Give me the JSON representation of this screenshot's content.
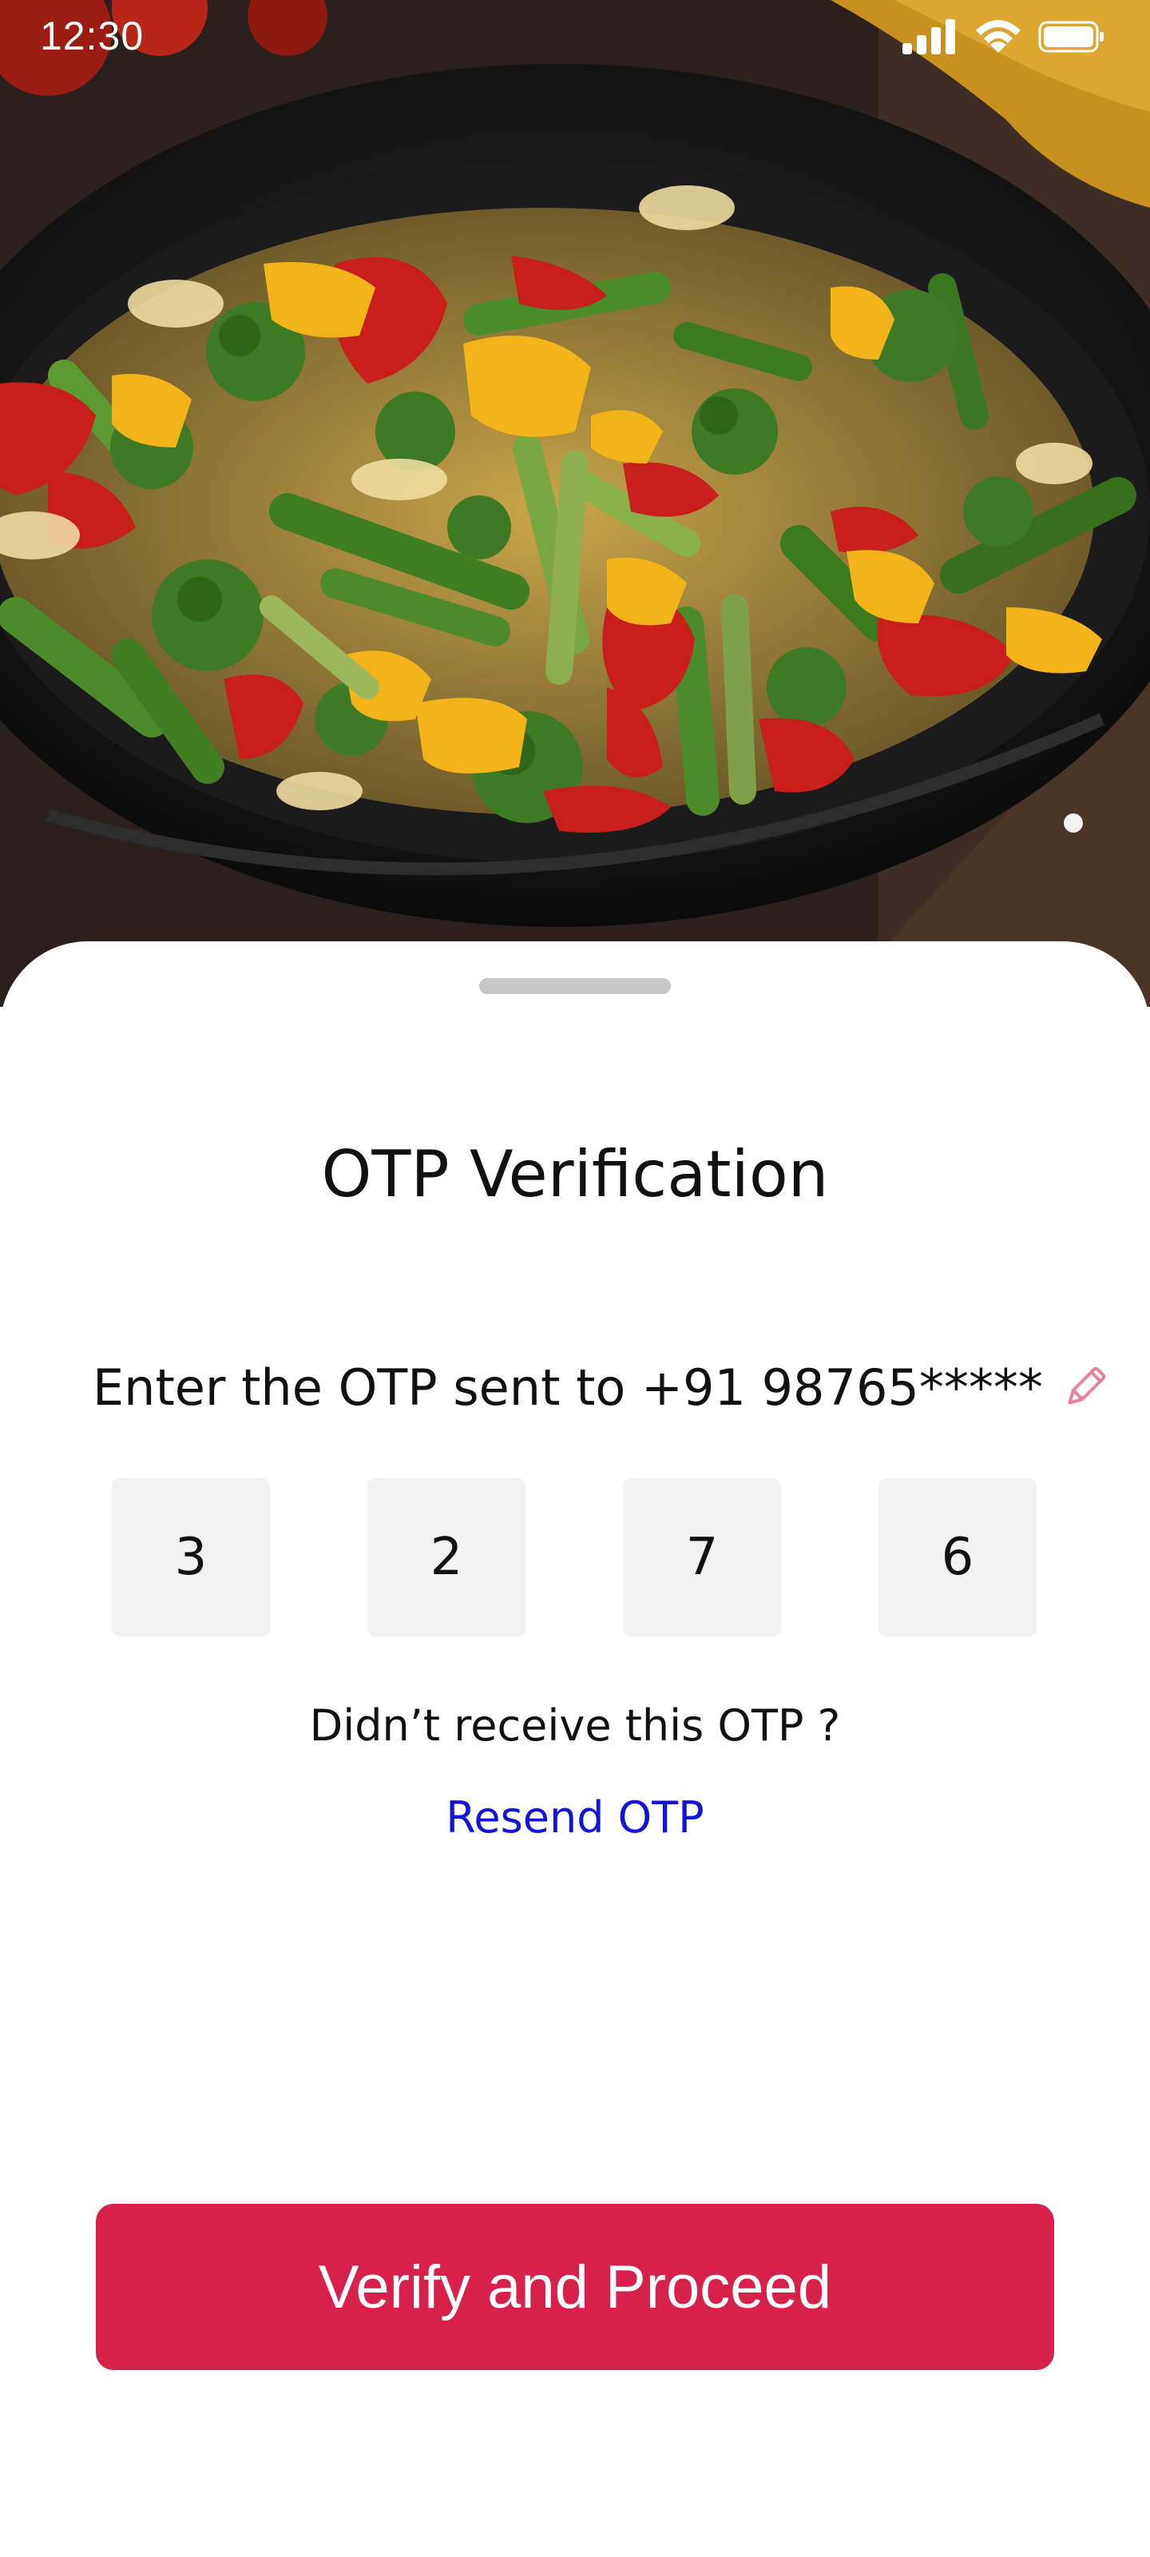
{
  "status_bar": {
    "time": "12:30",
    "icons": [
      "cellular-signal-icon",
      "wifi-icon",
      "battery-icon"
    ]
  },
  "hero": {
    "image": "stir-fried vegetables in pan",
    "icon": "hero-food-image"
  },
  "sheet": {
    "title": "OTP Verification",
    "prompt": "Enter the OTP sent to +91 98765*****",
    "edit_icon": "pencil-icon",
    "otp_digits": [
      "3",
      "2",
      "7",
      "6"
    ],
    "resend_question": "Didn’t receive this OTP ?",
    "resend_link": "Resend OTP",
    "verify_button": "Verify and Proceed"
  },
  "colors": {
    "accent": "#d7204b",
    "link": "#1414d8",
    "otp_box_bg": "#f2f2f2",
    "edit_icon": "#e8849a"
  }
}
